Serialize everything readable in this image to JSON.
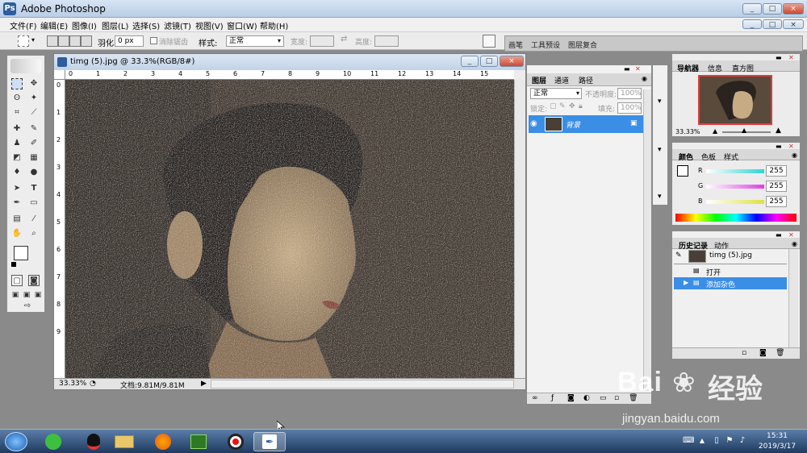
{
  "app": {
    "title": "Adobe Photoshop",
    "icon": "photoshop-icon",
    "window_buttons": [
      "_",
      "□",
      "×"
    ]
  },
  "menu": [
    "文件(F)",
    "编辑(E)",
    "图像(I)",
    "图层(L)",
    "选择(S)",
    "滤镜(T)",
    "视图(V)",
    "窗口(W)",
    "帮助(H)"
  ],
  "options": {
    "feather_label": "羽化:",
    "feather_value": "0 px",
    "antialias_label": "消除锯齿",
    "style_label": "样式:",
    "style_value": "正常",
    "width_label": "宽度:",
    "height_label": "高度:"
  },
  "palette_well": [
    "画笔",
    "工具预设",
    "图层复合"
  ],
  "document": {
    "title": "timg (5).jpg @ 33.3%(RGB/8#)",
    "ruler_h": [
      "0",
      "1",
      "2",
      "3",
      "4",
      "5",
      "6",
      "7",
      "8",
      "9",
      "10",
      "11",
      "12",
      "13",
      "14",
      "15"
    ],
    "ruler_v": [
      "0",
      "1",
      "2",
      "3",
      "4",
      "5",
      "6",
      "7",
      "8",
      "9"
    ],
    "zoom": "33.33%",
    "doc_size": "文档:9.81M/9.81M"
  },
  "layers_panel": {
    "tabs": [
      "图层",
      "通道",
      "路径"
    ],
    "blend_mode": "正常",
    "opacity_label": "不透明度:",
    "opacity_value": "100%",
    "lock_label": "锁定:",
    "fill_label": "填充:",
    "fill_value": "100%",
    "layer_name": "背景"
  },
  "navigator": {
    "tabs": [
      "导航器",
      "信息",
      "直方图"
    ],
    "zoom": "33.33%"
  },
  "color_panel": {
    "tabs": [
      "颜色",
      "色板",
      "样式"
    ],
    "channels": [
      {
        "label": "R",
        "value": "255",
        "color": "#2dd4d4"
      },
      {
        "label": "G",
        "value": "255",
        "color": "#e040e0"
      },
      {
        "label": "B",
        "value": "255",
        "color": "#e0e040"
      }
    ]
  },
  "history_panel": {
    "tabs": [
      "历史记录",
      "动作"
    ],
    "snapshot": "timg (5).jpg",
    "items": [
      "打开",
      "添加杂色"
    ],
    "selected_index": 1
  },
  "taskbar": {
    "time": "15:31",
    "date": "2019/3/17"
  },
  "watermark": {
    "brand": "Bai",
    "brand2": "经验",
    "url": "jingyan.baidu.com"
  }
}
